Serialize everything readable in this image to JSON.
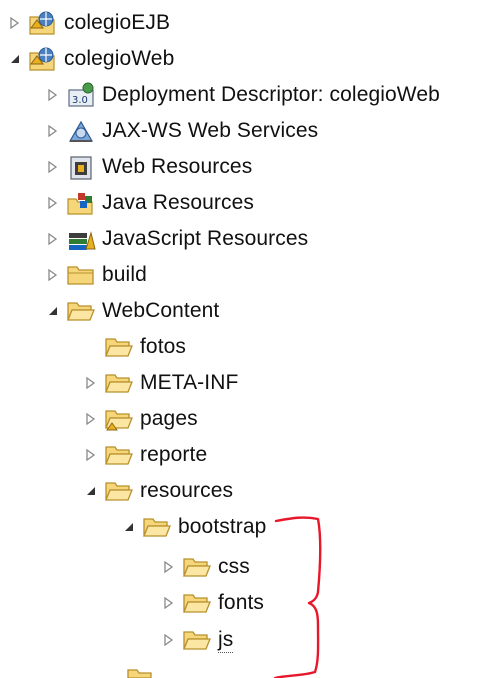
{
  "colors": {
    "folder_fill": "#f5d67a",
    "folder_stroke": "#b8902c",
    "expander": "#333333",
    "collapsed_expander": "#8a8a8a",
    "annotation": "#e8182c",
    "text": "#111111"
  },
  "tree": [
    {
      "label": "colegioEJB",
      "icon": "project-icon",
      "state": "collapsed"
    },
    {
      "label": "colegioWeb",
      "icon": "project-icon",
      "state": "expanded"
    },
    {
      "label": "Deployment Descriptor: colegioWeb",
      "icon": "deployment-descriptor-icon",
      "state": "collapsed"
    },
    {
      "label": "JAX-WS Web Services",
      "icon": "web-services-icon",
      "state": "collapsed"
    },
    {
      "label": "Web Resources",
      "icon": "web-resources-icon",
      "state": "collapsed"
    },
    {
      "label": "Java Resources",
      "icon": "java-resources-icon",
      "state": "collapsed"
    },
    {
      "label": "JavaScript Resources",
      "icon": "javascript-resources-icon",
      "state": "collapsed"
    },
    {
      "label": "build",
      "icon": "folder-icon",
      "state": "collapsed"
    },
    {
      "label": "WebContent",
      "icon": "folder-open-icon",
      "state": "expanded"
    },
    {
      "label": "fotos",
      "icon": "folder-open-icon",
      "state": "leaf"
    },
    {
      "label": "META-INF",
      "icon": "folder-open-icon",
      "state": "collapsed"
    },
    {
      "label": "pages",
      "icon": "folder-open-icon",
      "state": "collapsed"
    },
    {
      "label": "reporte",
      "icon": "folder-open-icon",
      "state": "collapsed"
    },
    {
      "label": "resources",
      "icon": "folder-open-icon",
      "state": "expanded"
    },
    {
      "label": "bootstrap",
      "icon": "folder-open-icon",
      "state": "expanded"
    },
    {
      "label": "css",
      "icon": "folder-open-icon",
      "state": "collapsed"
    },
    {
      "label": "fonts",
      "icon": "folder-open-icon",
      "state": "collapsed"
    },
    {
      "label": "js",
      "icon": "folder-open-icon",
      "state": "collapsed"
    }
  ]
}
